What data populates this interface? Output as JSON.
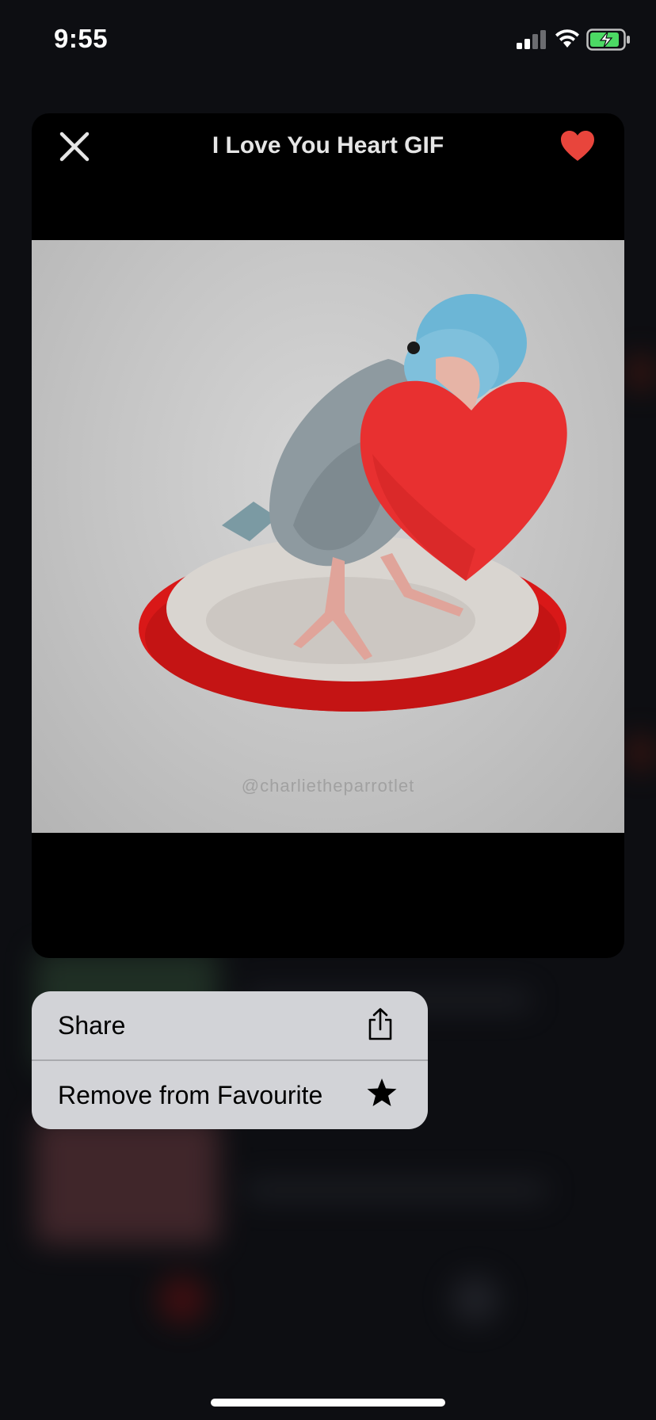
{
  "status_bar": {
    "time": "9:55"
  },
  "preview": {
    "title": "I Love You Heart GIF",
    "close_icon": "close-icon",
    "favorite_icon": "heart-icon",
    "favorite_color": "#e8453c",
    "watermark": "@charlietheparrotlet"
  },
  "context_menu": {
    "items": [
      {
        "label": "Share",
        "icon": "share-icon"
      },
      {
        "label": "Remove from Favourite",
        "icon": "star-icon"
      }
    ]
  },
  "colors": {
    "menu_background": "#d2d3d7",
    "card_background": "#000000",
    "battery_green": "#4cd964"
  }
}
